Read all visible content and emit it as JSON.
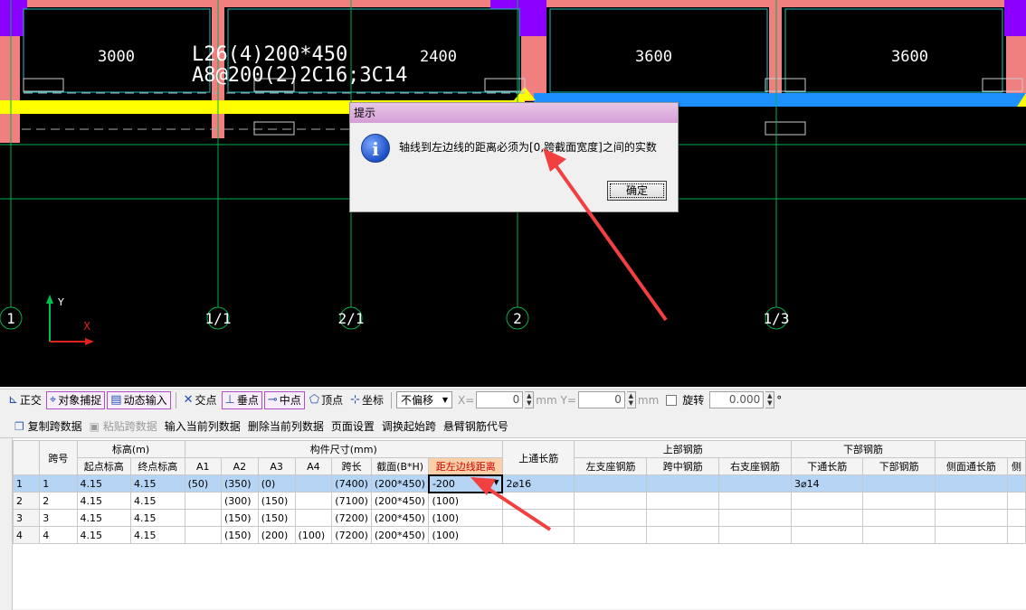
{
  "cad": {
    "dims": [
      "3000",
      "2400",
      "3600",
      "3600"
    ],
    "beam_line1": "L26(4)200*450",
    "beam_line2": "A8@200(2)2C16;3C14",
    "axes": [
      "1",
      "1/1",
      "2/1",
      "2",
      "1/3"
    ],
    "ucs_y": "Y",
    "ucs_x": "X"
  },
  "dialog": {
    "title": "提示",
    "icon": "info-icon",
    "message": "轴线到左边线的距离必须为[0,跨截面宽度]之间的实数",
    "ok_label": "确定"
  },
  "toolbar1": {
    "items": [
      "正交",
      "对象捕捉",
      "动态输入",
      "交点",
      "垂点",
      "中点",
      "顶点",
      "坐标"
    ],
    "offset_select": "不偏移",
    "x_label": "X=",
    "x_value": "0",
    "y_label": "mm Y=",
    "y_value": "0",
    "unit": "mm",
    "rotate_label": "旋转",
    "rotate_value": "0.000",
    "degree": "°"
  },
  "toolbar2": {
    "items": [
      "复制跨数据",
      "粘贴跨数据",
      "输入当前列数据",
      "删除当前列数据",
      "页面设置",
      "调换起始跨",
      "悬臂钢筋代号"
    ]
  },
  "table": {
    "group_headers": {
      "span_no": "跨号",
      "elevation": "标高(m)",
      "size": "构件尺寸(mm)",
      "top_through": "上通长筋",
      "top_rebar": "上部钢筋",
      "bottom_rebar": "下部钢筋"
    },
    "sub_headers": [
      "起点标高",
      "终点标高",
      "A1",
      "A2",
      "A3",
      "A4",
      "跨长",
      "截面(B*H)",
      "距左边线距离",
      "左支座钢筋",
      "跨中钢筋",
      "右支座钢筋",
      "下通长筋",
      "下部钢筋",
      "侧面通长筋",
      "侧"
    ],
    "rows": [
      {
        "n": "1",
        "span": "1",
        "start": "4.15",
        "end": "4.15",
        "a1": "(50)",
        "a2": "(350)",
        "a3": "(0)",
        "a4": "",
        "len": "(7400)",
        "sec": "(200*450)",
        "dist": "-200",
        "top": "2⌀16",
        "ls": "",
        "mid": "",
        "rs": "",
        "bt": "3⌀14",
        "b": "",
        "side": ""
      },
      {
        "n": "2",
        "span": "2",
        "start": "4.15",
        "end": "4.15",
        "a1": "",
        "a2": "(300)",
        "a3": "(150)",
        "a4": "",
        "len": "(7100)",
        "sec": "(200*450)",
        "dist": "(100)",
        "top": "",
        "ls": "",
        "mid": "",
        "rs": "",
        "bt": "",
        "b": "",
        "side": ""
      },
      {
        "n": "3",
        "span": "3",
        "start": "4.15",
        "end": "4.15",
        "a1": "",
        "a2": "(150)",
        "a3": "(150)",
        "a4": "",
        "len": "(7200)",
        "sec": "(200*450)",
        "dist": "(100)",
        "top": "",
        "ls": "",
        "mid": "",
        "rs": "",
        "bt": "",
        "b": "",
        "side": ""
      },
      {
        "n": "4",
        "span": "4",
        "start": "4.15",
        "end": "4.15",
        "a1": "",
        "a2": "(150)",
        "a3": "(200)",
        "a4": "(100)",
        "len": "(7200)",
        "sec": "(200*450)",
        "dist": "(100)",
        "top": "",
        "ls": "",
        "mid": "",
        "rs": "",
        "bt": "",
        "b": "",
        "side": ""
      }
    ]
  },
  "colors": {
    "column": "#f08080",
    "column_cap": "#8b00ff",
    "beam_yellow": "#ffff00",
    "beam_blue": "#1e90ff",
    "grid": "#00b050",
    "arrow": "#f24040"
  }
}
